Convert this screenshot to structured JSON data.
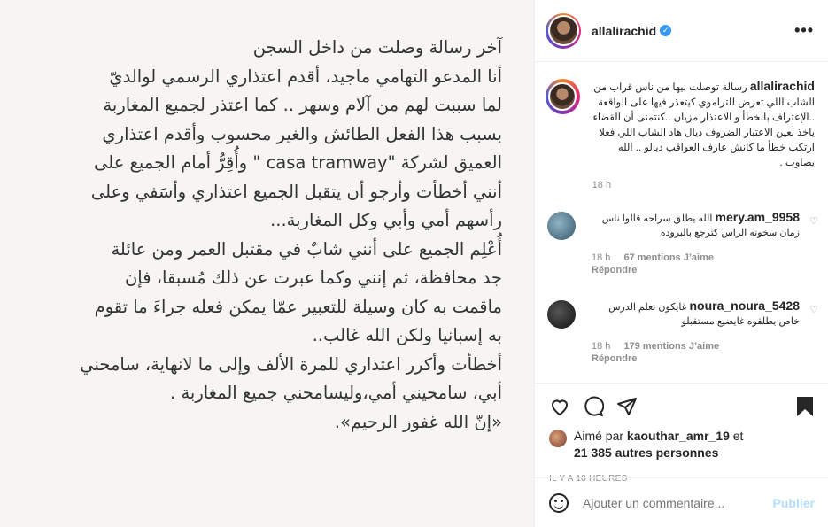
{
  "image_letter": {
    "lines": [
      "آخر رسالة وصلت من داخل السجن",
      "أنا المدعو التهامي ماجيد، أقدم اعتذاري الرسمي لوالديّ",
      "لما سببت لهم من آلام وسهر .. كما اعتذر لجميع المغاربة",
      "بسبب هذا الفعل الطائش والغير محسوب وأقدم اعتذاري",
      "العميق لشركة \"casa tramway \" وأُقِرُّ أمام الجميع على",
      "أنني أخطأت وأرجو أن يتقبل الجميع اعتذاري وأسَفي وعلى",
      "رأسهم أمي وأبي وكل المغاربة...",
      "أُعْلِم الجميع على أنني شابٌ في مقتبل العمر ومن عائلة",
      "جد محافظة، ثم إنني وكما عبرت عن ذلك مُسبقا، فإن",
      "ماقمت به كان وسيلة للتعبير عمّا يمكن فعله جراءَ ما تقوم",
      "به إسبانيا ولكن الله غالب..",
      "أخطأت وأكرر اعتذاري للمرة الألف وإلى ما لانهاية، سامحني",
      "أبي، سامحيني أمي،وليسامحني جميع المغاربة .",
      "«إنّ الله غفور الرحيم»."
    ]
  },
  "header": {
    "username": "allalirachid",
    "verified_icon": "verified-badge-icon",
    "more_label": "•••"
  },
  "caption": {
    "username": "allalirachid",
    "text": "رسالة توصلت بيها من ناس قراب من الشاب اللي تعرض للتراموي كيتعذر فيها على الواقعة ..الإعتراف بالخطأ و الاعتذار مزيان ..كنتمنى أن القضاء ياخذ بعين الاعتبار الضروف ديال هاد الشاب اللي فعلا ارتكب خطأ ما كانش عارف العواقب ديالو .. الله يصاوب .",
    "time": "18 h"
  },
  "comments": [
    {
      "username": "mery.am_9958",
      "text": "الله يطلق سراحه قالوا ناس زمان سخونه الراس كترجع بالبروده",
      "time": "18 h",
      "likes": "67 mentions J’aime",
      "reply": "Répondre"
    },
    {
      "username": "noura_noura_5428",
      "text": "غايكون تعلم الدرس خاص يطلقوه غايضيع مستقبلو",
      "time": "18 h",
      "likes": "179 mentions J’aime",
      "reply": "Répondre"
    }
  ],
  "actions": {
    "liked_by_prefix": "Aimé par",
    "liked_by_user": "kaouthar_amr_19",
    "liked_by_and": "et",
    "others_count": "21 385 autres personnes",
    "time_ago": "IL Y A 18 HEURES"
  },
  "add_comment": {
    "placeholder": "Ajouter un commentaire...",
    "publish_label": "Publier"
  },
  "colors": {
    "verified": "#3897f0",
    "publish_disabled": "#b2dffc",
    "muted": "#8e8e8e"
  }
}
